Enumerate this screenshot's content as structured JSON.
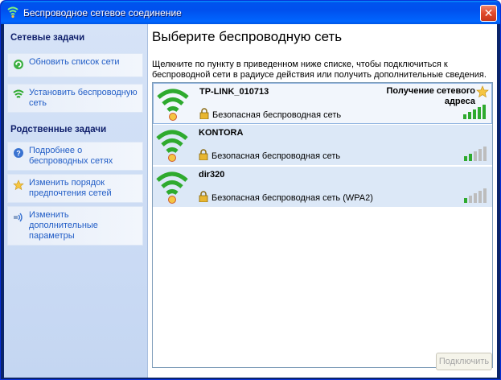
{
  "window": {
    "title": "Беспроводное сетевое соединение"
  },
  "sidebar": {
    "tasks_heading": "Сетевые задачи",
    "tasks": [
      {
        "label": "Обновить список сети",
        "icon": "refresh-icon"
      },
      {
        "label": "Установить беспроводную сеть",
        "icon": "wireless-setup-icon"
      }
    ],
    "related_heading": "Родственные задачи",
    "related": [
      {
        "label": "Подробнее о беспроводных сетях",
        "icon": "help-icon"
      },
      {
        "label": "Изменить порядок предпочтения сетей",
        "icon": "star-icon"
      },
      {
        "label": "Изменить дополнительные параметры",
        "icon": "network-settings-icon"
      }
    ]
  },
  "main": {
    "title": "Выберите беспроводную сеть",
    "description": "Щелкните по пункту в приведенном ниже списке, чтобы подключиться к беспроводной сети в радиусе действия или получить дополнительные сведения.",
    "networks": [
      {
        "name": "TP-LINK_010713",
        "security": "Безопасная беспроводная сеть",
        "status": "Получение сетевого адреса",
        "signal": 5,
        "preferred": true
      },
      {
        "name": "KONTORA",
        "security": "Безопасная беспроводная сеть",
        "status": "",
        "signal": 2,
        "preferred": false
      },
      {
        "name": "dir320",
        "security": "Безопасная беспроводная сеть (WPA2)",
        "status": "",
        "signal": 1,
        "preferred": false
      }
    ],
    "connect_label": "Подключить"
  },
  "colors": {
    "titlebar": "#0053ee",
    "sidebar_bg": "#d6e3f7",
    "link": "#215dc6",
    "signal_on": "#2eaa2e",
    "signal_off": "#bdbdbd"
  }
}
